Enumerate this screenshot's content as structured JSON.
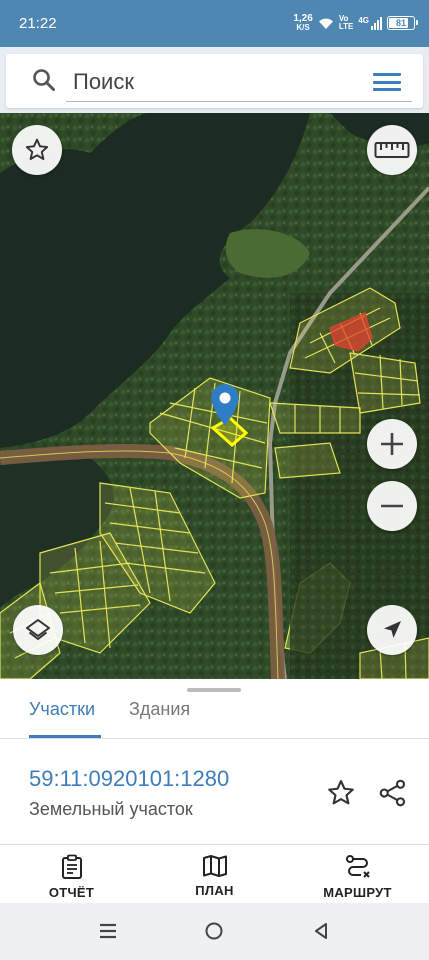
{
  "status_bar": {
    "time": "21:22",
    "net_speed": "1,26",
    "net_unit": "K/S",
    "volte": "Vo",
    "lte": "LTE",
    "network": "4G",
    "battery": "81",
    "battery_level": 0.81
  },
  "search": {
    "placeholder": "Поиск",
    "icon": "search-icon",
    "menu_icon": "hamburger-menu-icon"
  },
  "map": {
    "buttons": [
      "star-icon",
      "ruler-icon",
      "zoom-in-icon",
      "zoom-out-icon",
      "layers-icon",
      "locate-icon"
    ],
    "marker": "location-pin-icon",
    "colors": {
      "parcel_outline": "#e4e357",
      "selected_parcel": "#ffff00",
      "restricted_zone": "#e0412f",
      "water": "#1c2c22",
      "road": "#8a6a4a",
      "marker": "#2f7dc4"
    }
  },
  "tabs": {
    "active": "Участки",
    "inactive": "Здания"
  },
  "parcel": {
    "cadastral_number": "59:11:0920101:1280",
    "type": "Земельный участок"
  },
  "actions": [
    {
      "label": "ОТЧЁТ",
      "icon": "report-icon"
    },
    {
      "label": "ПЛАН",
      "icon": "map-plan-icon"
    },
    {
      "label": "МАРШРУТ",
      "icon": "route-icon"
    }
  ],
  "nav": [
    "recents-icon",
    "home-icon",
    "back-icon"
  ]
}
